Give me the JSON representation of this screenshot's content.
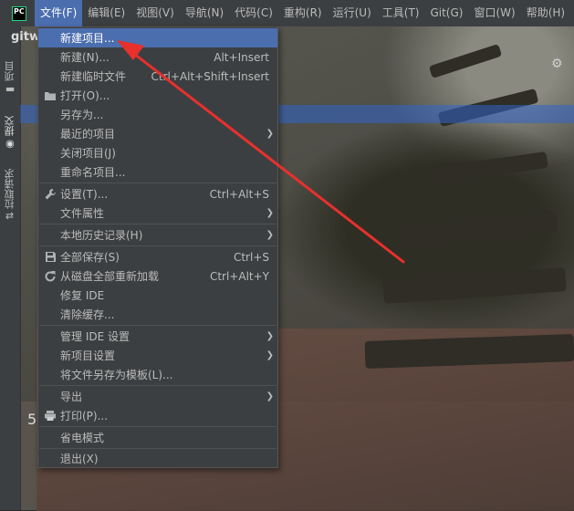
{
  "app_logo": "PC",
  "menubar": [
    {
      "label": "文件(F)",
      "active": true
    },
    {
      "label": "编辑(E)"
    },
    {
      "label": "视图(V)"
    },
    {
      "label": "导航(N)"
    },
    {
      "label": "代码(C)"
    },
    {
      "label": "重构(R)"
    },
    {
      "label": "运行(U)"
    },
    {
      "label": "工具(T)"
    },
    {
      "label": "Git(G)"
    },
    {
      "label": "窗口(W)"
    },
    {
      "label": "帮助(H)"
    }
  ],
  "side_strip": {
    "project": "项目",
    "commit": "提交",
    "pull_requests": "拉取请求"
  },
  "project_title": "gitw",
  "editor_fragment_number": "5",
  "file_menu": {
    "new_project": "新建项目...",
    "new": "新建(N)...",
    "new_shortcut": "Alt+Insert",
    "new_scratch": "新建临时文件",
    "new_scratch_shortcut": "Ctrl+Alt+Shift+Insert",
    "open": "打开(O)...",
    "save_as": "另存为...",
    "recent_projects": "最近的项目",
    "close_project": "关闭项目(J)",
    "rename_project": "重命名项目...",
    "settings": "设置(T)...",
    "settings_shortcut": "Ctrl+Alt+S",
    "file_properties": "文件属性",
    "local_history": "本地历史记录(H)",
    "save_all": "全部保存(S)",
    "save_all_shortcut": "Ctrl+S",
    "reload_all": "从磁盘全部重新加载",
    "reload_all_shortcut": "Ctrl+Alt+Y",
    "repair_ide": "修复 IDE",
    "invalidate_caches": "清除缓存...",
    "manage_ide_settings": "管理 IDE 设置",
    "new_project_settings": "新项目设置",
    "save_as_template": "将文件另存为模板(L)...",
    "export": "导出",
    "print": "打印(P)...",
    "power_save": "省电模式",
    "exit": "退出(X)"
  },
  "colors": {
    "menu_bg": "#3c3f41",
    "selection": "#4b6eaf",
    "annotation_arrow": "#e8302c"
  },
  "icons": {
    "open": "folder-icon",
    "settings": "wrench-icon",
    "save_all": "save-icon",
    "reload_all": "reload-icon",
    "print": "printer-icon"
  }
}
